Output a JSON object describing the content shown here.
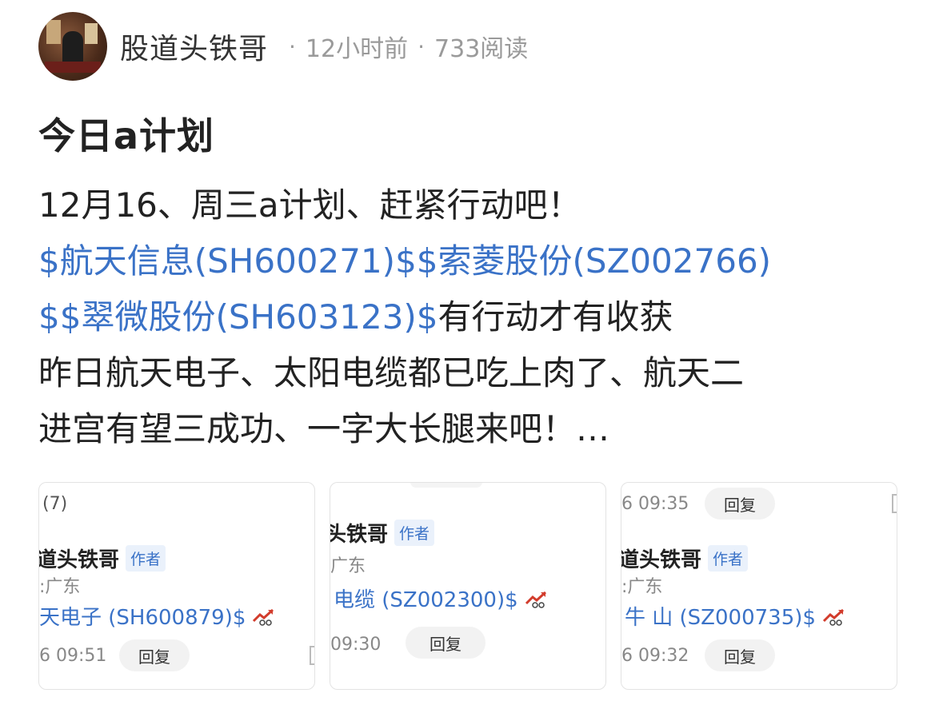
{
  "post": {
    "author": "股道头铁哥",
    "time": "12小时前",
    "reads": "733阅读",
    "title": "今日a计划",
    "line1": "12月16、周三a计划、赶紧行动吧！",
    "stock1": "$航天信息(SH600271)$",
    "stock2": "$索菱股份(SZ002766)",
    "stock2b": "$",
    "stock3": "$翠微股份(SH603123)$",
    "line3_tail": "有行动才有收获",
    "line4": "昨日航天电子、太阳电缆都已吃上肉了、航天二",
    "line5": "进宫有望三成功、一字大长腿来吧！…"
  },
  "cards": [
    {
      "count": "(7)",
      "name": "道头铁哥",
      "badge": "作者",
      "location": ":广东",
      "stock": "天电子 (SH600879)$",
      "time": "6 09:51",
      "reply": "回复"
    },
    {
      "name": "头铁哥",
      "badge": "作者",
      "location": "广东",
      "stock": "电缆 (SZ002300)$",
      "time": "09:30",
      "reply": "回复"
    },
    {
      "top_time": "6 09:35",
      "top_reply": "回复",
      "name": "道头铁哥",
      "badge": "作者",
      "location": ":广东",
      "stock": "牛 山 (SZ000735)$",
      "time": "6 09:32",
      "reply": "回复"
    }
  ],
  "colors": {
    "link": "#3a72c7",
    "meta": "#9a9a9a",
    "trend": "#d23c2c"
  },
  "icons": {
    "trend": "trend-up-icon"
  }
}
